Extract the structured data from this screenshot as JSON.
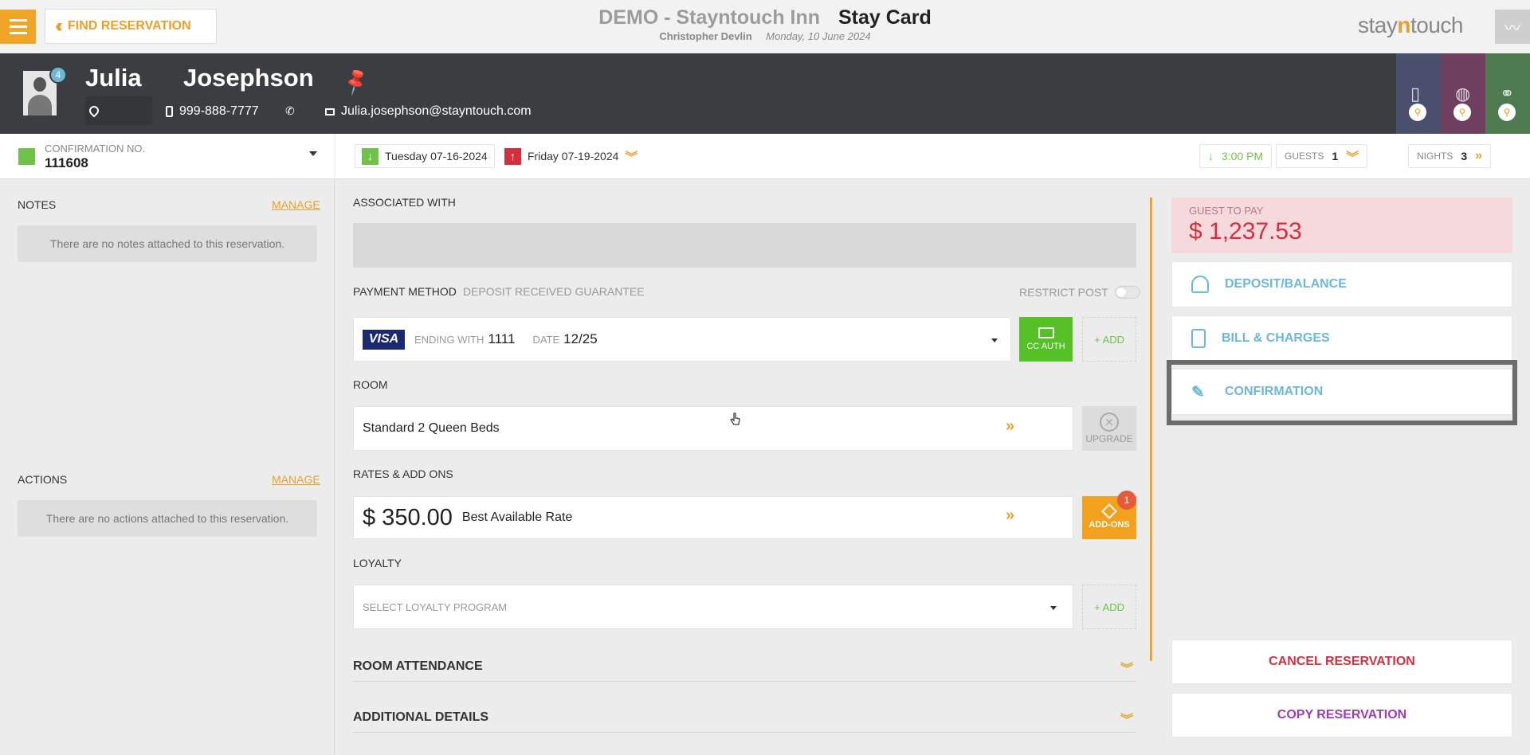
{
  "header": {
    "menu_label": "",
    "find_reservation": "FIND RESERVATION",
    "hotel_name": "DEMO - Stayntouch Inn",
    "page_title": "Stay Card",
    "user_name": "Christopher Devlin",
    "current_date": "Monday, 10 June 2024",
    "logo_prefix": "stay",
    "logo_mid": "n",
    "logo_suffix": "touch"
  },
  "guest": {
    "first_name": "Julia",
    "last_name": "Josephson",
    "avatar_badge": "4",
    "phone": "999-888-7777",
    "email": "Julia.josephson@stayntouch.com"
  },
  "confirmation": {
    "label": "CONFIRMATION NO.",
    "number": "111608"
  },
  "dates": {
    "arrival": "Tuesday 07-16-2024",
    "departure": "Friday 07-19-2024",
    "arrival_time": "3:00 PM",
    "guests_label": "GUESTS",
    "guests_count": "1",
    "nights_label": "NIGHTS",
    "nights_count": "3"
  },
  "notes": {
    "title": "NOTES",
    "manage": "MANAGE",
    "empty": "There are no notes attached to this reservation."
  },
  "actions": {
    "title": "ACTIONS",
    "manage": "MANAGE",
    "empty": "There are no actions attached to this reservation."
  },
  "reservation": {
    "associated_with_label": "ASSOCIATED WITH",
    "payment_method_label": "PAYMENT METHOD",
    "payment_guarantee": "DEPOSIT RECEIVED GUARANTEE",
    "restrict_post": "RESTRICT POST",
    "card_brand": "VISA",
    "ending_with_label": "ENDING WITH",
    "ending_with": "1111",
    "date_label": "DATE",
    "expiry": "12/25",
    "cc_auth": "CC AUTH",
    "add": "+ ADD",
    "room_label": "ROOM",
    "room_type": "Standard 2 Queen Beds",
    "upgrade": "UPGRADE",
    "rates_label": "RATES & ADD ONS",
    "rate_amount": "$ 350.00",
    "rate_name": "Best Available Rate",
    "addons": "ADD-ONS",
    "addons_badge": "1",
    "loyalty_label": "LOYALTY",
    "loyalty_placeholder": "SELECT LOYALTY PROGRAM",
    "room_attendance": "ROOM ATTENDANCE",
    "additional_details": "ADDITIONAL DETAILS"
  },
  "billing": {
    "guest_to_pay_label": "GUEST TO PAY",
    "guest_to_pay": "$ 1,237.53",
    "deposit_balance": "DEPOSIT/BALANCE",
    "bill_charges": "BILL & CHARGES",
    "confirmation": "CONFIRMATION",
    "cancel": "CANCEL RESERVATION",
    "copy": "COPY RESERVATION"
  },
  "colors": {
    "accent": "#f0a528",
    "header_dark": "#3b3d40",
    "link_blue": "#6cb8d8",
    "cancel_red": "#d3303f",
    "copy_purple": "#9b3fb0",
    "cc_green": "#55c127"
  }
}
